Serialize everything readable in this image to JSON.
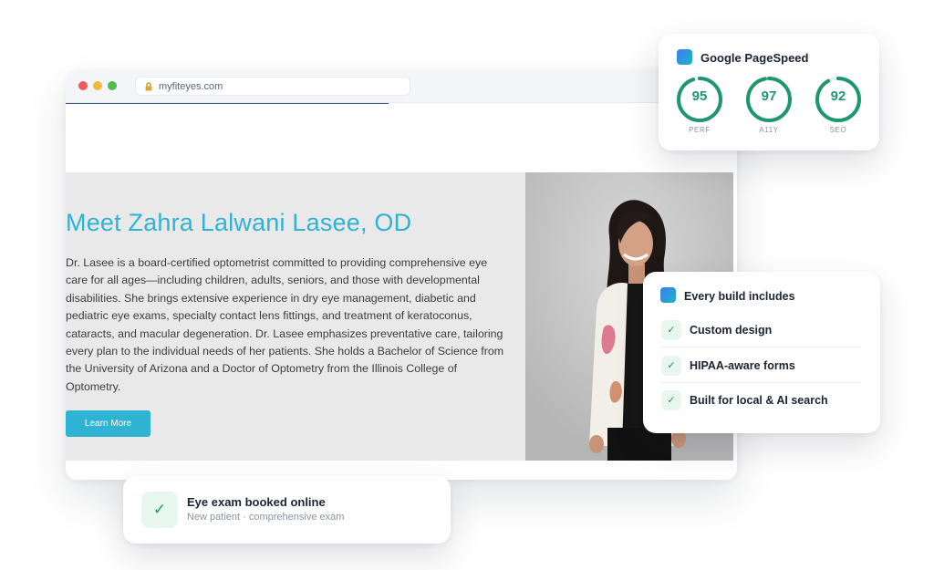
{
  "browser": {
    "url": "myfiteyes.com",
    "icons": [
      "lock-icon"
    ]
  },
  "hero": {
    "title": "Meet Zahra Lalwani Lasee, OD",
    "bio": "Dr. Lasee is a board-certified optometrist committed to providing comprehensive eye care for all ages—including children, adults, seniors, and those with developmental disabilities. She brings extensive experience in dry eye management, diabetic and pediatric eye exams, specialty contact lens fittings, and treatment of keratoconus, cataracts, and macular degeneration. Dr. Lasee emphasizes preventative care, tailoring every plan to the individual needs of her patients. She holds a Bachelor of Science from the University of Arizona and a Doctor of Optometry from the Illinois College of Optometry.",
    "button_label": "Learn More",
    "accent_color": "#2eb3d3"
  },
  "pagespeed": {
    "title": "Google PageSpeed",
    "scores": [
      {
        "label": "PERF",
        "value": "95",
        "percent": 95
      },
      {
        "label": "A11Y",
        "value": "97",
        "percent": 97
      },
      {
        "label": "SEO",
        "value": "92",
        "percent": 92
      }
    ],
    "score_color": "#1e9770"
  },
  "build": {
    "title": "Every build includes",
    "items": [
      {
        "label": "Custom design",
        "icon": "check-icon"
      },
      {
        "label": "HIPAA-aware forms",
        "icon": "check-icon"
      },
      {
        "label": "Built for local & AI search",
        "icon": "check-icon"
      }
    ]
  },
  "booked": {
    "title": "Eye exam booked online",
    "subtitle": "New patient · comprehensive exam",
    "icon": "check-icon"
  }
}
